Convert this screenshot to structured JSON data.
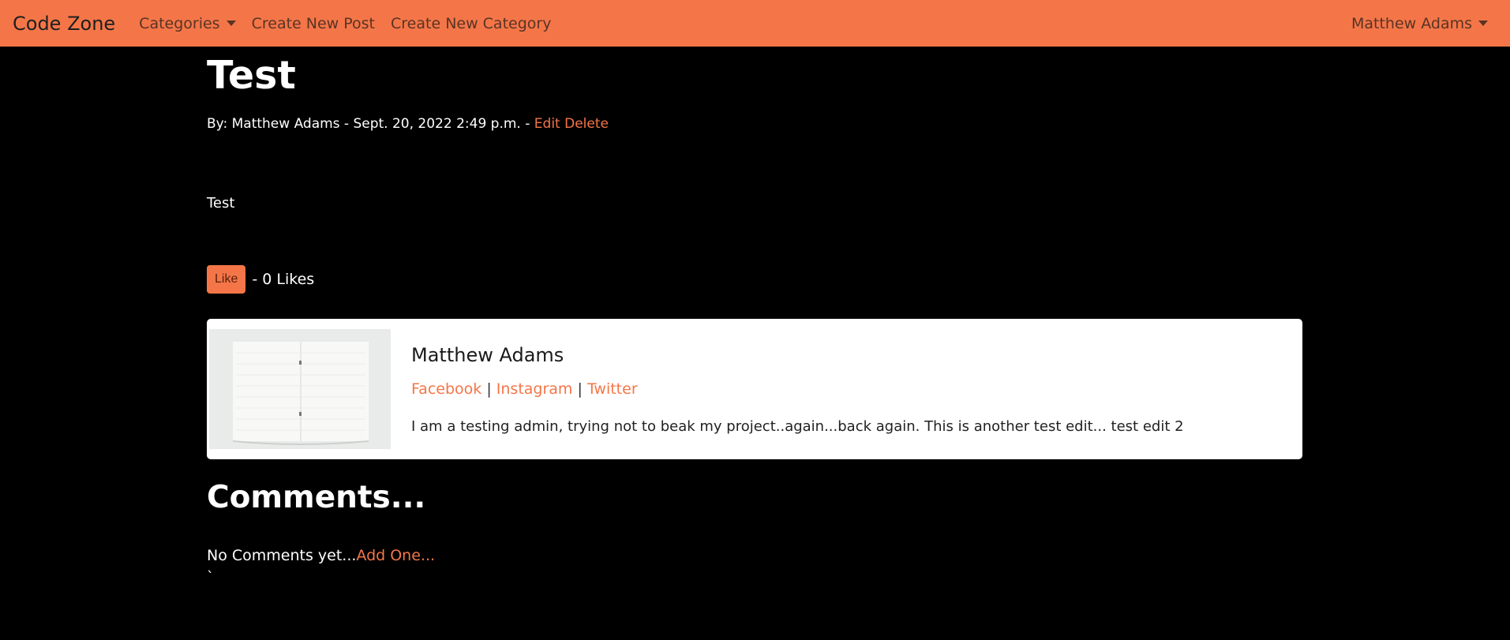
{
  "nav": {
    "brand": "Code Zone",
    "categories": "Categories",
    "create_post": "Create New Post",
    "create_category": "Create New Category",
    "user": "Matthew Adams"
  },
  "post": {
    "title": "Test",
    "meta_prefix": "By: Matthew Adams - Sept. 20, 2022 2:49 p.m. - ",
    "edit": "Edit",
    "delete": "Delete",
    "body": "Test"
  },
  "likes": {
    "button": "Like",
    "count_text": "- 0 Likes"
  },
  "author": {
    "name": "Matthew Adams",
    "facebook": "Facebook",
    "instagram": "Instagram",
    "twitter": "Twitter",
    "separator": "|",
    "bio": "I am a testing admin, trying not to beak my project..again...back again. This is another test edit... test edit 2"
  },
  "comments": {
    "heading": "Comments...",
    "empty_text": "No Comments yet...",
    "add_link": "Add One...",
    "stray": "`"
  },
  "colors": {
    "accent": "#f47648",
    "background": "#000000",
    "card": "#ffffff"
  }
}
